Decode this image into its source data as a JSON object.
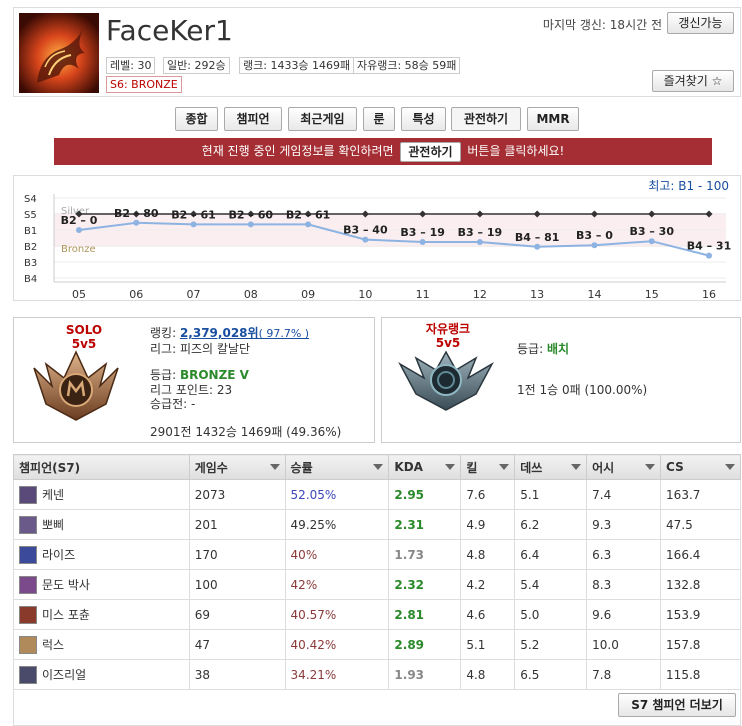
{
  "profile": {
    "name": "FaceKer1",
    "level": "레벨: 30",
    "normal": "일반: 292승",
    "rank": "랭크: 1433승 1469패",
    "flex": "자유랭크: 58승 59패",
    "season_badge": "S6: BRONZE",
    "last_update": "마지막 갱신: 18시간 전",
    "refresh_label": "갱신가능",
    "favorite_label": "즐겨찾기 ☆"
  },
  "tabs": [
    "종합",
    "챔피언",
    "최근게임",
    "룬",
    "특성",
    "관전하기",
    "MMR"
  ],
  "spectate": {
    "text_before": "현재 진행 중인 게임정보를 확인하려면",
    "button_label": "관전하기",
    "text_after": "버튼을 클릭하세요!"
  },
  "chart_data": {
    "type": "line",
    "title": "최고: B1 - 100",
    "y_tick_labels": [
      "S4",
      "S5",
      "B1",
      "B2",
      "B3",
      "B4"
    ],
    "tier_band_labels": [
      "Silver",
      "Bronze"
    ],
    "x": [
      "05",
      "06",
      "07",
      "08",
      "09",
      "10",
      "11",
      "12",
      "13",
      "14",
      "15",
      "16"
    ],
    "series": [
      {
        "role": "reference",
        "values": [
          "S5",
          "S5",
          "S5",
          "S5",
          "S5",
          "S5",
          "S5",
          "S5",
          "S5",
          "S5",
          "S5",
          "S5"
        ]
      },
      {
        "role": "player",
        "points": [
          {
            "label": "B2 – 0",
            "tier": 2.0
          },
          {
            "label": "B2 – 80",
            "tier": 1.55
          },
          {
            "label": "B2 – 61",
            "tier": 1.65
          },
          {
            "label": "B2 – 60",
            "tier": 1.65
          },
          {
            "label": "B2 – 61",
            "tier": 1.65
          },
          {
            "label": "B3 – 40",
            "tier": 2.6
          },
          {
            "label": "B3 – 19",
            "tier": 2.75
          },
          {
            "label": "B3 – 19",
            "tier": 2.75
          },
          {
            "label": "B4 – 81",
            "tier": 3.05
          },
          {
            "label": "B3 – 0",
            "tier": 2.95
          },
          {
            "label": "B3 – 30",
            "tier": 2.7
          },
          {
            "label": "B4 – 31",
            "tier": 3.6
          }
        ]
      }
    ],
    "colors": {
      "reference": "#333333",
      "player": "#8db3e2",
      "band": "#fbeef0"
    }
  },
  "solo": {
    "queue_label": "SOLO",
    "queue_sub": "5v5",
    "ranking_label": "랭킹:",
    "ranking_value": "2,379,028위",
    "ranking_pct": "( 97.7% )",
    "league": "리그: 피즈의 칼날단",
    "tier_label": "등급:",
    "tier": "BRONZE V",
    "lp": "리그 포인트: 23",
    "promo": "승급전: -",
    "record": "2901전 1432승 1469패 (49.36%)"
  },
  "flex_rank": {
    "queue_label": "자유랭크",
    "queue_sub": "5v5",
    "tier_label": "등급:",
    "tier": "배치",
    "record": "1전 1승 0패 (100.00%)"
  },
  "table": {
    "headers": [
      "챔피언(S7)",
      "게임수",
      "승률",
      "KDA",
      "킬",
      "데쓰",
      "어시",
      "CS"
    ],
    "rows": [
      {
        "champ": "케넨",
        "games": "2073",
        "wr": "52.05%",
        "kda": "2.95",
        "k": "7.6",
        "d": "5.1",
        "a": "7.4",
        "cs": "163.7",
        "wr_cls": "wr-blue",
        "kda_cls": "kda-green",
        "icon": "#5a4a7a"
      },
      {
        "champ": "뽀삐",
        "games": "201",
        "wr": "49.25%",
        "kda": "2.31",
        "k": "4.9",
        "d": "6.2",
        "a": "9.3",
        "cs": "47.5",
        "wr_cls": "",
        "kda_cls": "kda-green",
        "icon": "#6a5a8a"
      },
      {
        "champ": "라이즈",
        "games": "170",
        "wr": "40%",
        "kda": "1.73",
        "k": "4.8",
        "d": "6.4",
        "a": "6.3",
        "cs": "166.4",
        "wr_cls": "wr-dark",
        "kda_cls": "kda-gray",
        "icon": "#3b4a9a"
      },
      {
        "champ": "문도 박사",
        "games": "100",
        "wr": "42%",
        "kda": "2.32",
        "k": "4.2",
        "d": "5.4",
        "a": "8.3",
        "cs": "132.8",
        "wr_cls": "wr-dark",
        "kda_cls": "kda-green",
        "icon": "#7a4a8a"
      },
      {
        "champ": "미스 포츈",
        "games": "69",
        "wr": "40.57%",
        "kda": "2.81",
        "k": "4.6",
        "d": "5.0",
        "a": "9.6",
        "cs": "153.9",
        "wr_cls": "wr-dark",
        "kda_cls": "kda-green",
        "icon": "#8a3a2a"
      },
      {
        "champ": "럭스",
        "games": "47",
        "wr": "40.42%",
        "kda": "2.89",
        "k": "5.1",
        "d": "5.2",
        "a": "10.0",
        "cs": "157.8",
        "wr_cls": "wr-dark",
        "kda_cls": "kda-green",
        "icon": "#b08a5a"
      },
      {
        "champ": "이즈리얼",
        "games": "38",
        "wr": "34.21%",
        "kda": "1.93",
        "k": "4.8",
        "d": "6.5",
        "a": "7.8",
        "cs": "115.8",
        "wr_cls": "wr-dark",
        "kda_cls": "kda-gray",
        "icon": "#4a4a6a"
      }
    ],
    "more_label": "S7 챔피언 더보기"
  }
}
